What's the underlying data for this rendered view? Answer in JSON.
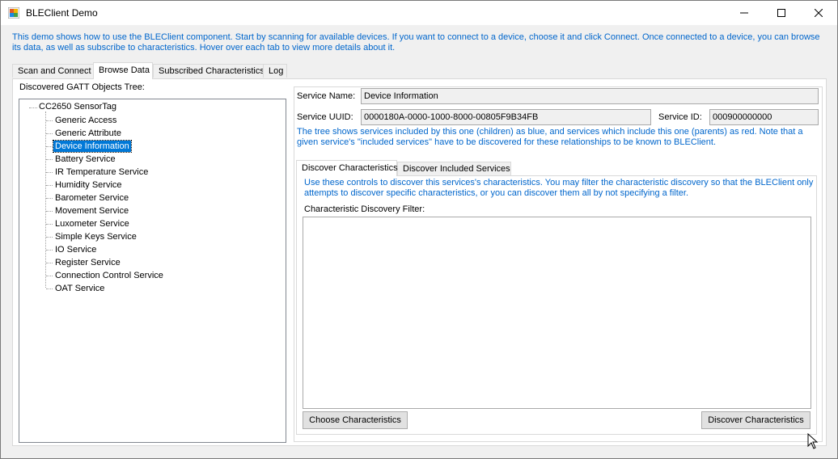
{
  "window": {
    "title": "BLEClient Demo",
    "intro": "This demo shows how to use the BLEClient component. Start by scanning for available devices. If you want to connect to a device, choose it and click Connect. Once connected to a device, you can browse its data, as well as subscribe to characteristics. Hover over each tab to view more details about it."
  },
  "tabs": [
    {
      "label": "Scan and Connect"
    },
    {
      "label": "Browse Data"
    },
    {
      "label": "Subscribed Characteristics"
    },
    {
      "label": "Log"
    }
  ],
  "browse": {
    "tree_label": "Discovered GATT Objects Tree:",
    "tree_root": "CC2650 SensorTag",
    "tree_items": [
      {
        "label": "Generic Access"
      },
      {
        "label": "Generic Attribute"
      },
      {
        "label": "Device Information"
      },
      {
        "label": "Battery Service"
      },
      {
        "label": "IR Temperature Service"
      },
      {
        "label": "Humidity Service"
      },
      {
        "label": "Barometer Service"
      },
      {
        "label": "Movement Service"
      },
      {
        "label": "Luxometer Service"
      },
      {
        "label": "Simple Keys Service"
      },
      {
        "label": "IO Service"
      },
      {
        "label": "Register Service"
      },
      {
        "label": "Connection Control Service"
      },
      {
        "label": "OAT Service"
      }
    ],
    "selected_item": "Device Information",
    "service_name_label": "Service Name:",
    "service_name_value": "Device Information",
    "service_uuid_label": "Service UUID:",
    "service_uuid_value": "0000180A-0000-1000-8000-00805F9B34FB",
    "service_id_label": "Service ID:",
    "service_id_value": "000900000000",
    "tree_help": "The tree shows services included by this one (children) as blue, and services which include this one (parents) as red. Note that a given service's \"included services\" have to be discovered for these relationships to be known to BLEClient.",
    "inner_tabs": [
      {
        "label": "Discover Characteristics"
      },
      {
        "label": "Discover Included Services"
      }
    ],
    "discover_help": "Use these controls to discover this services's characteristics. You may filter the characteristic discovery so that the BLEClient only attempts to discover specific characteristics, or you can discover them all by not specifying a filter.",
    "filter_label": "Characteristic Discovery Filter:",
    "filter_value": "",
    "choose_button": "Choose Characteristics",
    "discover_button": "Discover Characteristics"
  },
  "colors": {
    "help_text": "#0066cc",
    "selection": "#0078d7"
  }
}
